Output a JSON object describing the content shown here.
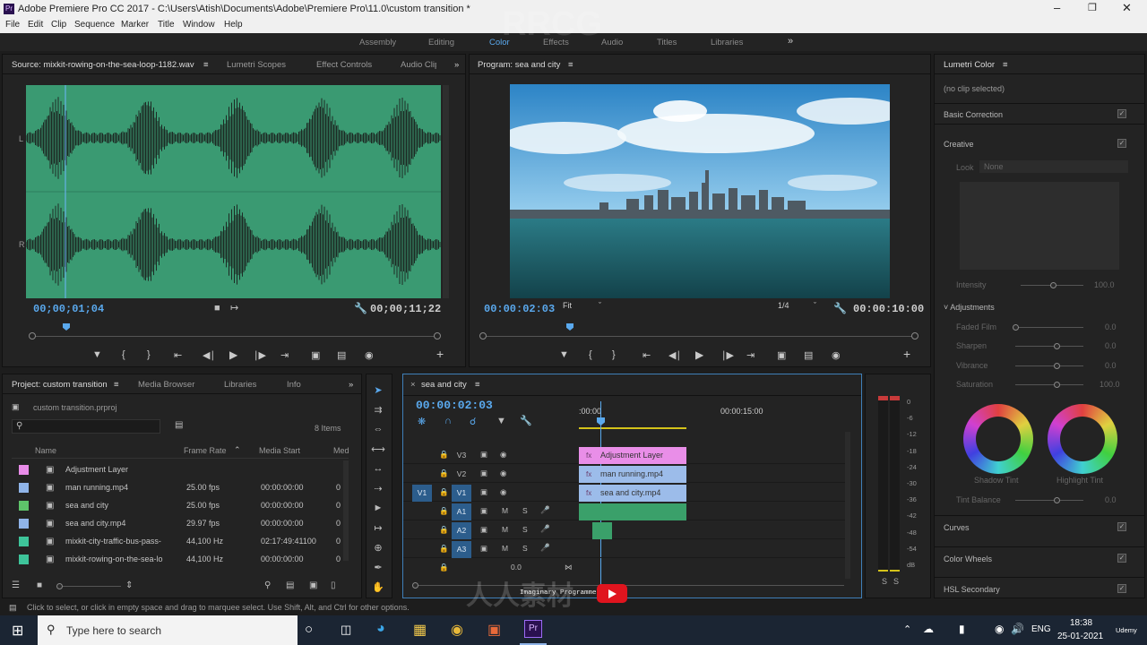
{
  "title_bar": {
    "text": "Adobe Premiere Pro CC 2017 - C:\\Users\\Atish\\Documents\\Adobe\\Premiere Pro\\11.0\\custom transition *"
  },
  "menu": [
    "File",
    "Edit",
    "Clip",
    "Sequence",
    "Marker",
    "Title",
    "Window",
    "Help"
  ],
  "workspaces": [
    "Assembly",
    "Editing",
    "Color",
    "Effects",
    "Audio",
    "Titles",
    "Libraries"
  ],
  "active_workspace": "Color",
  "source_panel": {
    "tabs": [
      "Source: mixkit-rowing-on-the-sea-loop-1182.wav",
      "Lumetri Scopes",
      "Effect Controls",
      "Audio Clip"
    ],
    "channel_labels": [
      "L",
      "R"
    ],
    "current_timecode": "00;00;01;04",
    "duration_timecode": "00;00;11;22",
    "waveform_color": "#3a9a72"
  },
  "program_panel": {
    "title": "Program: sea and city",
    "current_timecode": "00:00:02:03",
    "zoom": "Fit",
    "resolution": "1/4",
    "duration_timecode": "00:00:10:00"
  },
  "project_panel": {
    "tabs": [
      "Project: custom transition",
      "Media Browser",
      "Libraries",
      "Info"
    ],
    "project_file": "custom transition.prproj",
    "item_count": "8 Items",
    "columns": [
      "Name",
      "Frame Rate",
      "Media Start",
      "Med"
    ],
    "items": [
      {
        "name": "Adjustment Layer",
        "frame_rate": "",
        "media_start": "",
        "color": "#e88ce8"
      },
      {
        "name": "man running.mp4",
        "frame_rate": "25.00 fps",
        "media_start": "00:00:00:00",
        "color": "#8fb4e8"
      },
      {
        "name": "sea and city",
        "frame_rate": "25.00 fps",
        "media_start": "00:00:00:00",
        "color": "#5ec46a"
      },
      {
        "name": "sea and city.mp4",
        "frame_rate": "29.97 fps",
        "media_start": "00:00:00:00",
        "color": "#8fb4e8"
      },
      {
        "name": "mixkit-city-traffic-bus-pass-",
        "frame_rate": "44,100 Hz",
        "media_start": "02:17:49:41100",
        "color": "#3ec49a"
      },
      {
        "name": "mixkit-rowing-on-the-sea-lo",
        "frame_rate": "44,100 Hz",
        "media_start": "00:00:00:00",
        "color": "#3ec49a"
      }
    ]
  },
  "timeline": {
    "sequence_name": "sea and city",
    "current_timecode": "00:00:02:03",
    "ruler": [
      ":00:00",
      "00:00:15:00"
    ],
    "video_tracks": [
      "V3",
      "V2",
      "V1"
    ],
    "audio_tracks": [
      "A1",
      "A2",
      "A3"
    ],
    "source_patch": "V1",
    "master_level": "0.0",
    "clips": [
      {
        "track": "V3",
        "name": "Adjustment Layer",
        "color": "#e98ee8"
      },
      {
        "track": "V2",
        "name": "man running.mp4",
        "color": "#9cbcea"
      },
      {
        "track": "V1",
        "name": "sea and city.mp4",
        "color": "#9cbcea"
      }
    ]
  },
  "meter_scale": [
    "0",
    "-6",
    "-12",
    "-18",
    "-24",
    "-30",
    "-36",
    "-42",
    "-48",
    "-54",
    "dB"
  ],
  "meter_solo": [
    "S",
    "S"
  ],
  "lumetri": {
    "title": "Lumetri Color",
    "no_clip": "(no clip selected)",
    "sections": [
      "Basic Correction",
      "Creative",
      "Curves",
      "Color Wheels",
      "HSL Secondary"
    ],
    "look_label": "Look",
    "look_value": "None",
    "intensity_label": "Intensity",
    "intensity_value": "100.0",
    "adjustments_label": "Adjustments",
    "adjustments": [
      {
        "label": "Faded Film",
        "value": "0.0"
      },
      {
        "label": "Sharpen",
        "value": "0.0"
      },
      {
        "label": "Vibrance",
        "value": "0.0"
      },
      {
        "label": "Saturation",
        "value": "100.0"
      }
    ],
    "wheel_labels": [
      "Shadow Tint",
      "Highlight Tint"
    ],
    "tint_balance_label": "Tint Balance",
    "tint_balance_value": "0.0"
  },
  "status_bar": "Click to select, or click in empty space and drag to marquee select. Use Shift, Alt, and Ctrl for other options.",
  "overlay": {
    "channel": "Imaginary Programmer",
    "watermark": "RRCG",
    "watermark_cn": "人人素材"
  },
  "taskbar": {
    "search_placeholder": "Type here to search",
    "language": "ENG",
    "time": "18:38",
    "date": "25-01-2021",
    "udemy": "Udemy"
  }
}
